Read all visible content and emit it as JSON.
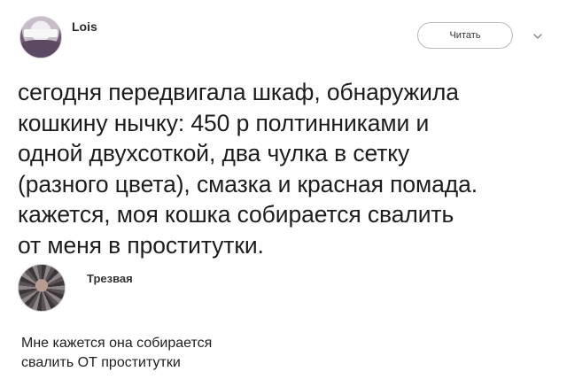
{
  "post": {
    "author": "Lois",
    "follow_label": "Читать",
    "text_lines": [
      "сегодня передвигала шкаф, обнаружила",
      "кошкину нычку: 450 р полтинниками и",
      "одной двухсоткой, два чулка в сетку",
      "(разного цвета), смазка и красная помада.",
      "кажется, моя кошка  собирается свалить",
      "от меня в проститутки."
    ]
  },
  "reply": {
    "author": "Трезвая",
    "text_lines": [
      "Мне кажется она  собирается",
      "свалить ОТ проститутки"
    ]
  },
  "icons": {
    "post_menu": "chevron-down-icon"
  },
  "colors": {
    "text": "#1d1d1d",
    "button_border": "#b9b9b9",
    "background": "#ffffff"
  }
}
